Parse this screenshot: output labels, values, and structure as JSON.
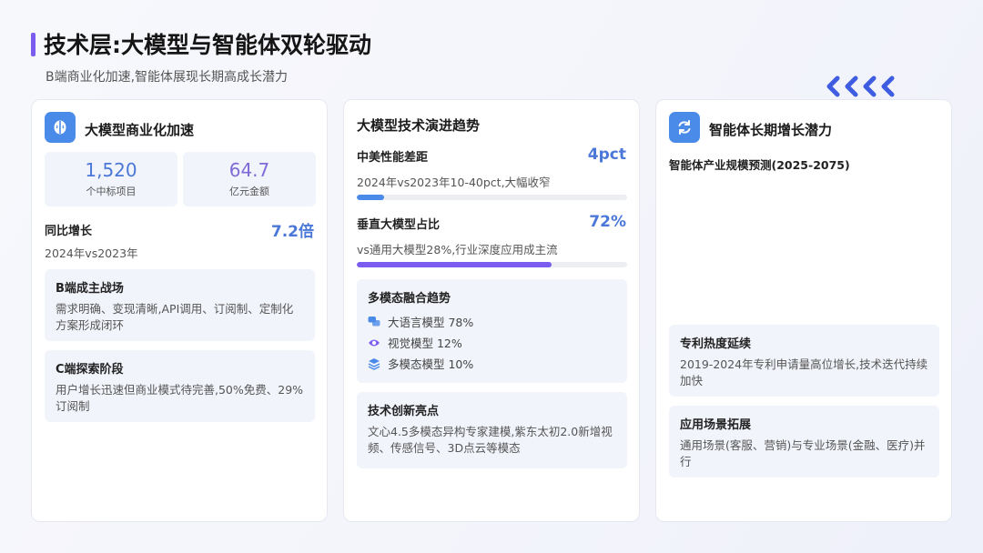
{
  "header": {
    "title": "技术层:大模型与智能体双轮驱动",
    "subtitle": "B端商业化加速,智能体展现长期高成长潜力",
    "accent_color": "#7b5cf0"
  },
  "card1": {
    "icon": "brain-icon",
    "title": "大模型商业化加速",
    "stats": [
      {
        "value": "1,520",
        "label": "个中标项目"
      },
      {
        "value": "64.7",
        "label": "亿元金额"
      }
    ],
    "growth_label": "同比增长",
    "growth_value": "7.2倍",
    "growth_note": "2024年vs2023年",
    "boxes": [
      {
        "title": "B端成主战场",
        "text": "需求明确、变现清晰,API调用、订阅制、定制化方案形成闭环"
      },
      {
        "title": "C端探索阶段",
        "text": "用户增长迅速但商业模式待完善,50%免费、29%订阅制"
      }
    ]
  },
  "card2": {
    "title": "大模型技术演进趋势",
    "metrics": [
      {
        "label": "中美性能差距",
        "value": "4pct",
        "note": "2024年vs2023年10-40pct,大幅收窄",
        "progress": 0.1,
        "color": "#4a8ae8"
      },
      {
        "label": "垂直大模型占比",
        "value": "72%",
        "note": "vs通用大模型28%,行业深度应用成主流",
        "progress": 0.72,
        "color": "#7b5cf0"
      }
    ],
    "multimodal": {
      "title": "多模态融合趋势",
      "items": [
        {
          "icon": "chat-bubbles-icon",
          "text": "大语言模型 78%"
        },
        {
          "icon": "eye-icon",
          "text": "视觉模型 12%"
        },
        {
          "icon": "layers-icon",
          "text": "多模态模型 10%"
        }
      ]
    },
    "innovation": {
      "title": "技术创新亮点",
      "text": "文心4.5多模态异构专家建模,紫东太初2.0新增视频、传感信号、3D点云等模态"
    }
  },
  "card3": {
    "icon": "refresh-icon",
    "title": "智能体长期增长潜力",
    "chart_caption": "智能体产业规模预测(2025-2075)",
    "boxes": [
      {
        "title": "专利热度延续",
        "text": "2019-2024年专利申请量高位增长,技术迭代持续加快"
      },
      {
        "title": "应用场景拓展",
        "text": "通用场景(客服、营销)与专业场景(金融、医疗)并行"
      }
    ]
  }
}
